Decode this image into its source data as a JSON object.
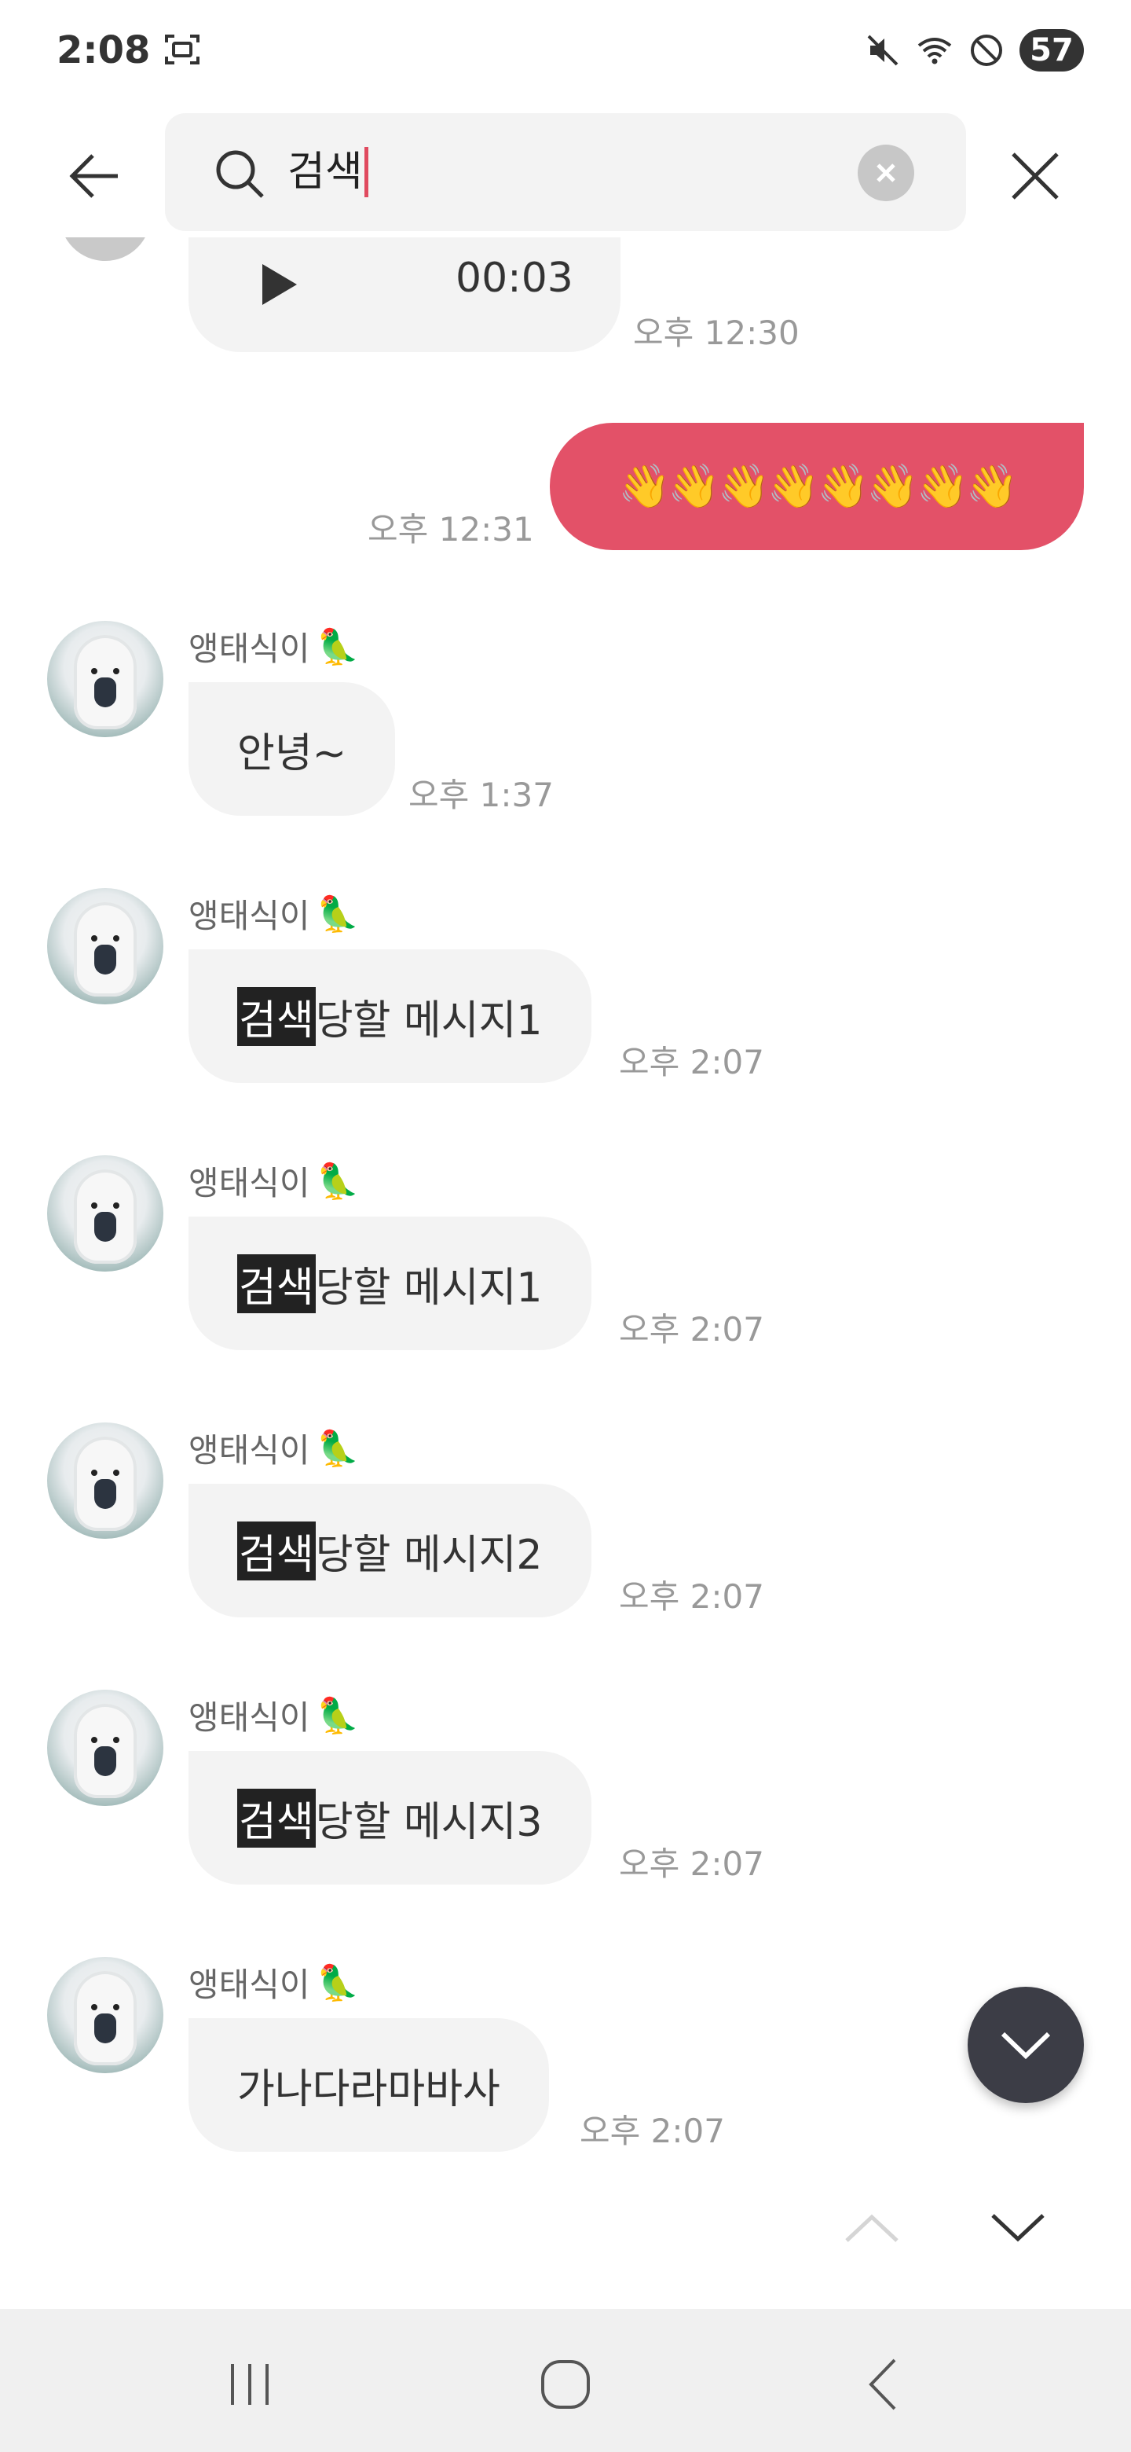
{
  "status_bar": {
    "time": "2:08",
    "battery": "57",
    "icons": [
      "screenshot-icon",
      "mute-icon",
      "wifi-icon",
      "do-not-disturb-icon",
      "battery-icon"
    ]
  },
  "search": {
    "query": "검색",
    "back_icon": "arrow-left-icon",
    "search_icon": "magnifier-icon",
    "clear_icon": "clear-x-icon",
    "close_icon": "close-x-icon"
  },
  "chat": {
    "voice_message": {
      "duration": "00:03",
      "time": "오후 12:30"
    },
    "sent_message": {
      "text": "👋👋👋👋👋👋👋👋",
      "time": "오후 12:31",
      "color": "#e35168"
    },
    "messages": [
      {
        "sender": "앵태식이",
        "emoji": "🦜",
        "highlight": "",
        "rest": "안녕~",
        "time": "오후 1:37"
      },
      {
        "sender": "앵태식이",
        "emoji": "🦜",
        "highlight": "검색",
        "rest": "당할 메시지1",
        "time": "오후 2:07"
      },
      {
        "sender": "앵태식이",
        "emoji": "🦜",
        "highlight": "검색",
        "rest": "당할 메시지1",
        "time": "오후 2:07"
      },
      {
        "sender": "앵태식이",
        "emoji": "🦜",
        "highlight": "검색",
        "rest": "당할 메시지2",
        "time": "오후 2:07"
      },
      {
        "sender": "앵태식이",
        "emoji": "🦜",
        "highlight": "검색",
        "rest": "당할 메시지3",
        "time": "오후 2:07"
      },
      {
        "sender": "앵태식이",
        "emoji": "🦜",
        "highlight": "",
        "rest": "가나다라마바사",
        "time": "오후 2:07"
      }
    ]
  },
  "controls": {
    "scroll_down_icon": "chevron-down-icon",
    "prev_result_icon": "chevron-up-icon",
    "next_result_icon": "chevron-down-icon"
  },
  "nav_bar": {
    "icons": [
      "recent-apps-icon",
      "home-icon",
      "back-icon"
    ]
  }
}
